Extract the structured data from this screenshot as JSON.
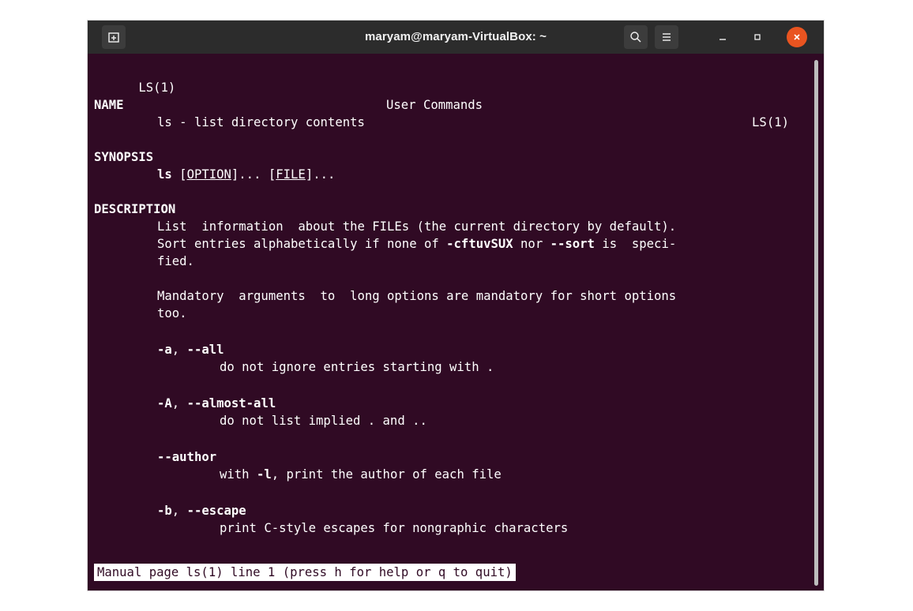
{
  "window": {
    "title": "maryam@maryam-VirtualBox: ~"
  },
  "icons": {
    "new_tab": "new-tab-icon",
    "search": "search-icon",
    "menu": "hamburger-menu-icon",
    "minimize": "minimize-icon",
    "maximize": "maximize-icon",
    "close": "close-icon"
  },
  "colors": {
    "terminal_bg": "#300a24",
    "titlebar_bg": "#2c2c2c",
    "close_accent": "#e95420"
  },
  "man": {
    "header_left": "LS(1)",
    "header_center": "User Commands",
    "header_right": "LS(1)",
    "name_heading": "NAME",
    "name_text": "ls - list directory contents",
    "synopsis_heading": "SYNOPSIS",
    "synopsis_cmd": "ls",
    "synopsis_open1": "[",
    "synopsis_option": "OPTION",
    "synopsis_mid": "]... [",
    "synopsis_file": "FILE",
    "synopsis_end": "]...",
    "description_heading": "DESCRIPTION",
    "desc_line1": "List  information  about the FILEs (the current directory by default).",
    "desc_line2_a": "Sort entries alphabetically if none of ",
    "desc_line2_flags": "-cftuvSUX",
    "desc_line2_b": " nor ",
    "desc_line2_sort": "--sort",
    "desc_line2_c": " is  speci-",
    "desc_line3": "fied.",
    "mand_line1": "Mandatory  arguments  to  long options are mandatory for short options",
    "mand_line2": "too.",
    "opt_a_short": "-a",
    "opt_sep": ", ",
    "opt_a_long": "--all",
    "opt_a_desc": "do not ignore entries starting with .",
    "opt_A_short": "-A",
    "opt_A_long": "--almost-all",
    "opt_A_desc": "do not list implied . and ..",
    "opt_author": "--author",
    "opt_author_desc_a": "with ",
    "opt_author_desc_flag": "-l",
    "opt_author_desc_b": ", print the author of each file",
    "opt_b_short": "-b",
    "opt_b_long": "--escape",
    "opt_b_desc": "print C-style escapes for nongraphic characters"
  },
  "status_bar": {
    "text": "Manual page ls(1) line 1 (press h for help or q to quit)"
  }
}
